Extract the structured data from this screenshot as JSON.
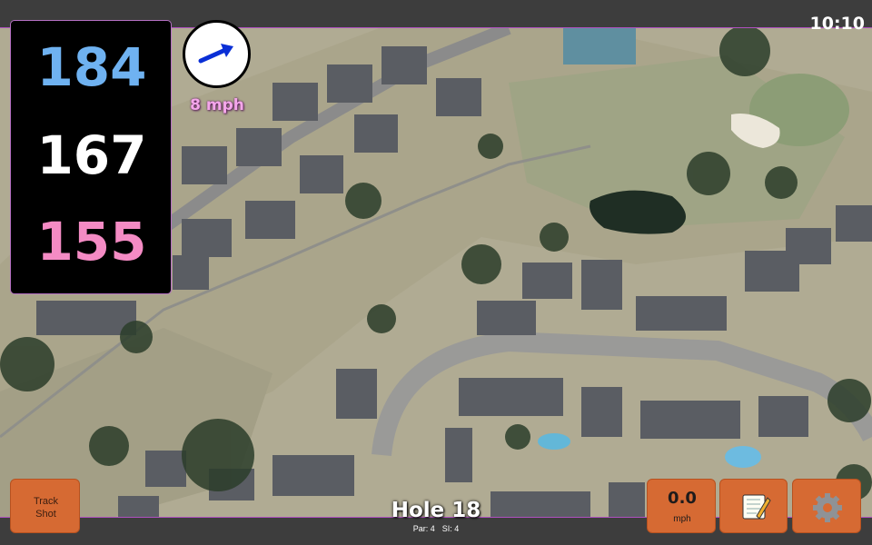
{
  "status": {
    "clock": "10:10"
  },
  "distances": {
    "back": "184",
    "middle": "167",
    "front": "155"
  },
  "wind": {
    "speed": "8 mph",
    "direction": "east-northeast",
    "arrow_color": "#0a2fd6"
  },
  "buttons": {
    "track_shot_line1": "Track",
    "track_shot_line2": "Shot",
    "speed_value": "0.0",
    "speed_unit": "mph",
    "notes_icon": "notepad-icon",
    "settings_icon": "gear-icon"
  },
  "hole": {
    "title": "Hole 18",
    "par": "Par: 4",
    "si": "SI: 4"
  },
  "colors": {
    "back_distance": "#6fb2f1",
    "middle_distance": "#ffffff",
    "front_distance": "#f48bc4",
    "button_orange": "#d66a33",
    "wind_label": "#f4a6ea"
  }
}
